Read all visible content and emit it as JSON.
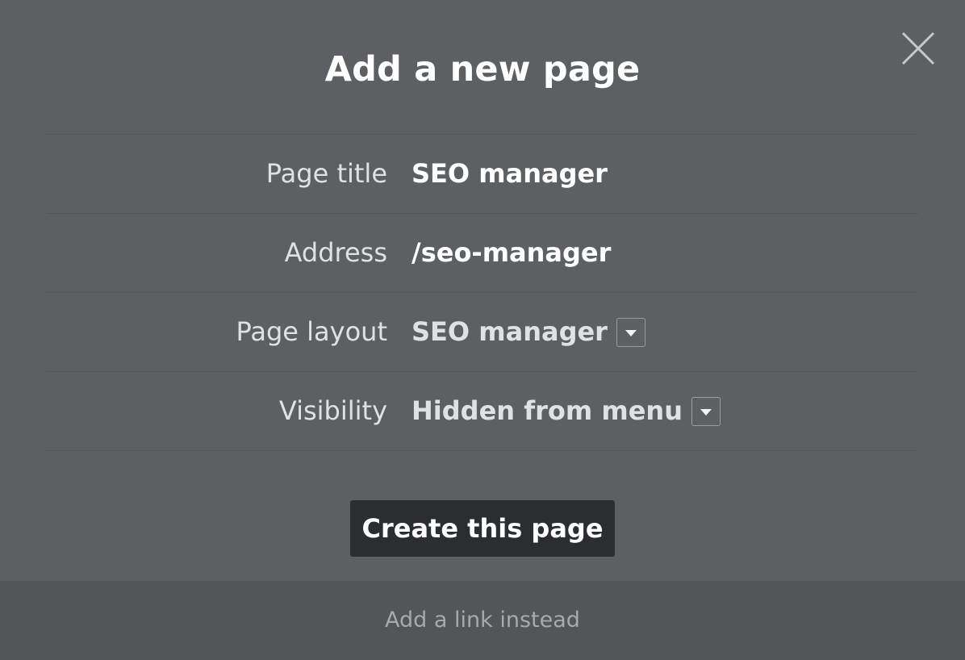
{
  "dialog": {
    "title": "Add a new page",
    "close_icon": "close-icon"
  },
  "fields": [
    {
      "label": "Page title",
      "value": "SEO manager"
    },
    {
      "label": "Address",
      "value": "/seo-manager"
    },
    {
      "label": "Page layout",
      "value": "SEO manager",
      "dropdown_icon": "chevron-down-icon"
    },
    {
      "label": "Visibility",
      "value": "Hidden from menu",
      "dropdown_icon": "chevron-down-icon"
    }
  ],
  "actions": {
    "create_label": "Create this page"
  },
  "footer": {
    "link_label": "Add a link instead"
  },
  "colors": {
    "background": "#5d6062",
    "footer_background": "#525656",
    "button_background": "#2a2e31",
    "text": "#ffffff",
    "muted_text": "#a7aaac"
  }
}
